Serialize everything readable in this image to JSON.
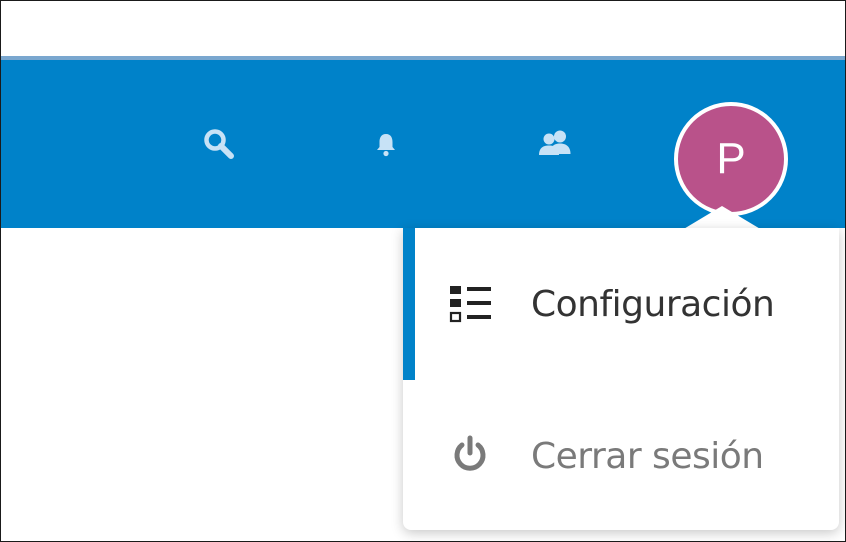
{
  "colors": {
    "header_bg": "#0082c9",
    "header_border": "#7aa7cf",
    "icon_tint": "#c7e2f6",
    "avatar_bg": "#b9528a",
    "active_accent": "#0082c9",
    "menu_text_primary": "#333333",
    "menu_text_secondary": "#7a7a7a",
    "menu_icon_primary": "#222222",
    "menu_icon_secondary": "#7a7a7a"
  },
  "header": {
    "icons": [
      {
        "name": "search-icon",
        "interactable": true
      },
      {
        "name": "notifications-bell-icon",
        "interactable": true
      },
      {
        "name": "contacts-icon",
        "interactable": true
      }
    ],
    "avatar": {
      "initial": "P"
    }
  },
  "user_menu": {
    "items": [
      {
        "icon": "settings-list-icon",
        "label": "Configuración",
        "active": true
      },
      {
        "icon": "power-icon",
        "label": "Cerrar sesión",
        "active": false
      }
    ]
  }
}
